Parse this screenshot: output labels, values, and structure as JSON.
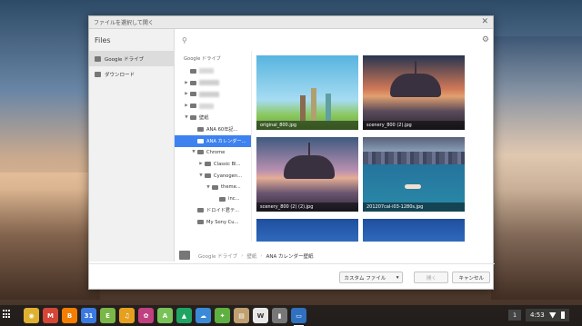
{
  "dialog": {
    "title": "ファイルを選択して開く",
    "close_glyph": "✕"
  },
  "left_pane": {
    "app_title": "Files",
    "items": [
      {
        "label": "Google ドライブ",
        "selected": true
      },
      {
        "label": "ダウンロード",
        "selected": false
      }
    ]
  },
  "search": {
    "icon": "search-icon",
    "settings_icon": "gear-icon"
  },
  "tree": {
    "root_label": "Google ドライブ",
    "wallpaper_folder": "壁紙",
    "ana60": "ANA 60年記...",
    "ana_cal": "ANA カレンダー...",
    "chrome": "Chrome",
    "classic": "Classic Bl...",
    "cyanogen": "Cyanogen...",
    "theme": "theme...",
    "inc": "inc...",
    "droid": "ドロイド君テ...",
    "mysony": "My Sony Cu..."
  },
  "files": [
    {
      "name": "original_800.jpg"
    },
    {
      "name": "scenery_800 (2).jpg"
    },
    {
      "name": "scenery_800 (2) (2).jpg"
    },
    {
      "name": "201207cal-i03-1280s.jpg"
    },
    {
      "name": ""
    },
    {
      "name": ""
    }
  ],
  "path": {
    "root": "Google ドライブ",
    "mid": "壁紙",
    "current": "ANA カレンダー壁紙",
    "separator": "›"
  },
  "actions": {
    "filter_label": "カスタム ファイル",
    "filter_caret": "▾",
    "open_label": "開く",
    "cancel_label": "キャンセル"
  },
  "shelf": {
    "apps": [
      {
        "name": "chrome-icon",
        "color": "#e0b030",
        "glyph": "◉"
      },
      {
        "name": "gmail-icon",
        "color": "#d44638",
        "glyph": "M"
      },
      {
        "name": "blogger-icon",
        "color": "#f57d00",
        "glyph": "B"
      },
      {
        "name": "calendar-icon",
        "color": "#3a7ae0",
        "glyph": "31"
      },
      {
        "name": "evernote-icon",
        "color": "#7ab648",
        "glyph": "E"
      },
      {
        "name": "headphones-icon",
        "color": "#e6a020",
        "glyph": "♫"
      },
      {
        "name": "photos-icon",
        "color": "#c04080",
        "glyph": "✿"
      },
      {
        "name": "android-icon",
        "color": "#78c257",
        "glyph": "A"
      },
      {
        "name": "drive-icon",
        "color": "#1fa463",
        "glyph": "▲"
      },
      {
        "name": "cloud-icon",
        "color": "#3b8ad8",
        "glyph": "☁"
      },
      {
        "name": "android-robot-icon",
        "color": "#5fb040",
        "glyph": "✦"
      },
      {
        "name": "notes-icon",
        "color": "#c0a070",
        "glyph": "▤"
      },
      {
        "name": "wordpress-icon",
        "color": "#e8e8e8",
        "glyph": "W"
      },
      {
        "name": "trash-icon",
        "color": "#777777",
        "glyph": "▮"
      },
      {
        "name": "files-icon",
        "color": "#3070c0",
        "glyph": "▭"
      }
    ],
    "workspace": "1",
    "time": "4:53"
  }
}
